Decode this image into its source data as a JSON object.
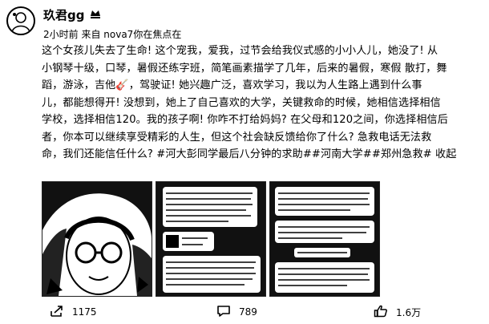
{
  "author": {
    "name": "玖君gg"
  },
  "meta": {
    "time": "2小时前",
    "source": "来自 nova7你在焦点在"
  },
  "post": {
    "lines": [
      "这个女孩儿失去了生命! 这个宠我，爱我，过节会给我仪式感的小小人儿，她没了! 从",
      "小钢琴十级，口琴，暑假还练字班，简笔画素描学了几年，后来的暑假，寒假 散打，舞",
      "蹈，游泳，吉他🎸，驾驶证! 她兴趣广泛，喜欢学习，我以为人生路上遇到什么事",
      "儿，都能想得开! 没想到，她上了自己喜欢的大学，关键救命的时候，她相信选择相信",
      "学校，选择相信120。我的孩子啊! 你咋不打给妈妈? 在父母和120之间，你选择相信后",
      "者，你本可以继续享受精彩的人生，但这个社会缺反馈给你了什么? 急救电话无法救",
      "命，我们还能信任什么? #河大彭同学最后八分钟的求助##河南大学##郑州急救#"
    ],
    "collapse_label": "收起"
  },
  "images": [
    {
      "label": "photo-of-girl"
    },
    {
      "label": "chat-screenshot-1"
    },
    {
      "label": "chat-screenshot-2"
    }
  ],
  "actions": {
    "share_count": "1175",
    "comment_count": "789",
    "like_count": "1.6万"
  }
}
